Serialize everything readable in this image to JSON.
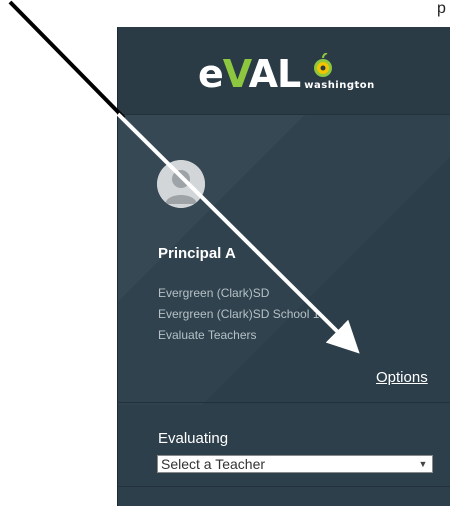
{
  "top_fragment": "p",
  "logo": {
    "e": "e",
    "v": "V",
    "al": "AL",
    "sub": "washington"
  },
  "user": {
    "name": "Principal A",
    "district": "Evergreen (Clark)SD",
    "school": "Evergreen (Clark)SD School 1",
    "role": "Evaluate Teachers"
  },
  "options_label": "Options",
  "evaluating": {
    "label": "Evaluating",
    "selected": "Select a Teacher"
  },
  "colors": {
    "panel": "#2d3f4b",
    "accent": "#8dc63f",
    "arrow_black": "#000000",
    "arrow_white": "#ffffff"
  }
}
